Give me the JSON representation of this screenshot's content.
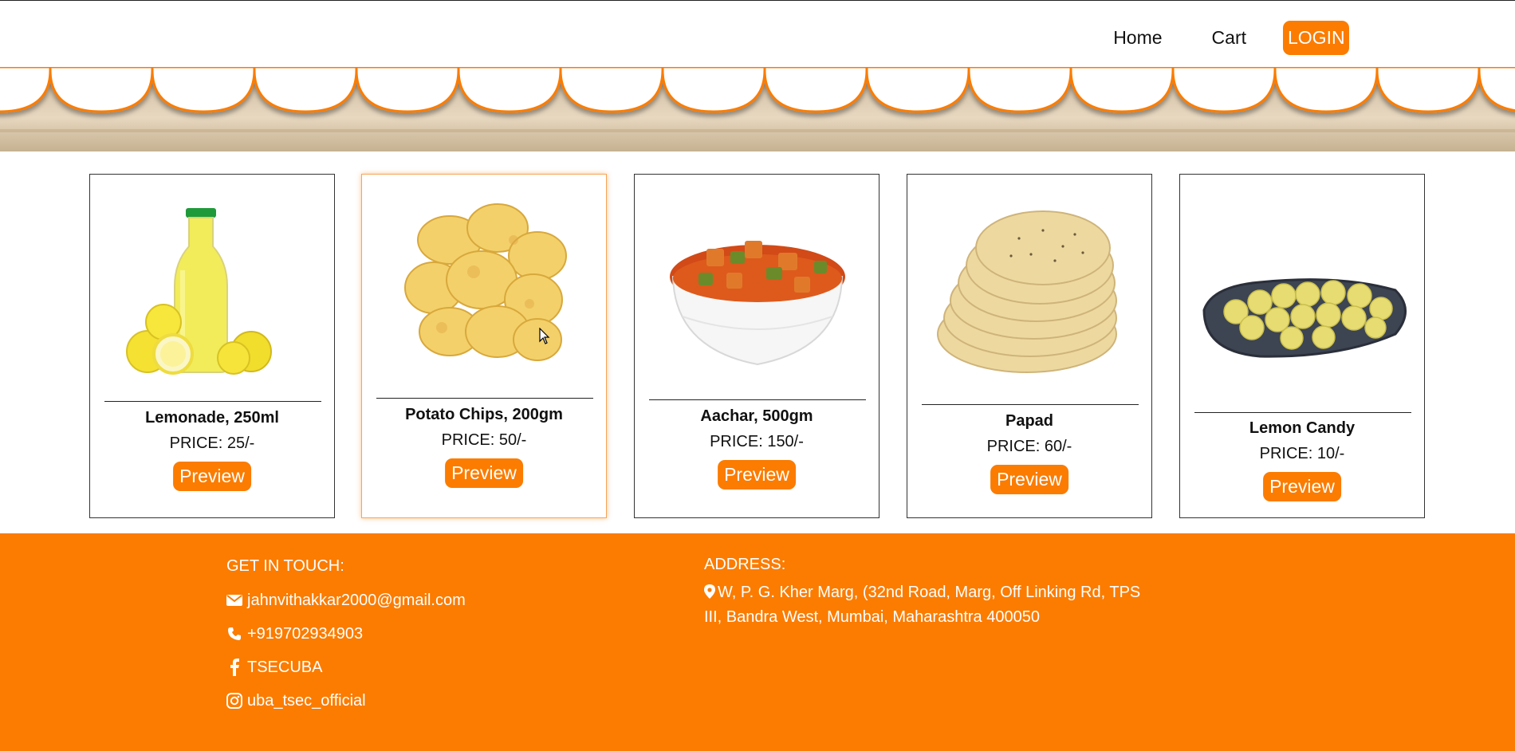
{
  "nav": {
    "home": "Home",
    "cart": "Cart",
    "login": "LOGIN"
  },
  "colors": {
    "accent": "#fb7c00"
  },
  "products": [
    {
      "name": "Lemonade, 250ml",
      "price": "PRICE: 25/-",
      "button": "Preview",
      "icon": "lemonade-image"
    },
    {
      "name": "Potato Chips, 200gm",
      "price": "PRICE: 50/-",
      "button": "Preview",
      "icon": "potato-chips-image"
    },
    {
      "name": "Aachar, 500gm",
      "price": "PRICE: 150/-",
      "button": "Preview",
      "icon": "aachar-image"
    },
    {
      "name": "Papad",
      "price": "PRICE: 60/-",
      "button": "Preview",
      "icon": "papad-image"
    },
    {
      "name": "Lemon Candy",
      "price": "PRICE: 10/-",
      "button": "Preview",
      "icon": "lemon-candy-image"
    }
  ],
  "footer": {
    "contact_title": "GET IN TOUCH:",
    "email": "jahnvithakkar2000@gmail.com",
    "phone": "+919702934903",
    "facebook": "TSECUBA",
    "instagram": "uba_tsec_official",
    "address_title": "ADDRESS:",
    "address_line1": "W, P. G. Kher Marg, (32nd Road, Marg, Off Linking Rd, TPS",
    "address_line2": "III, Bandra West, Mumbai, Maharashtra 400050"
  }
}
